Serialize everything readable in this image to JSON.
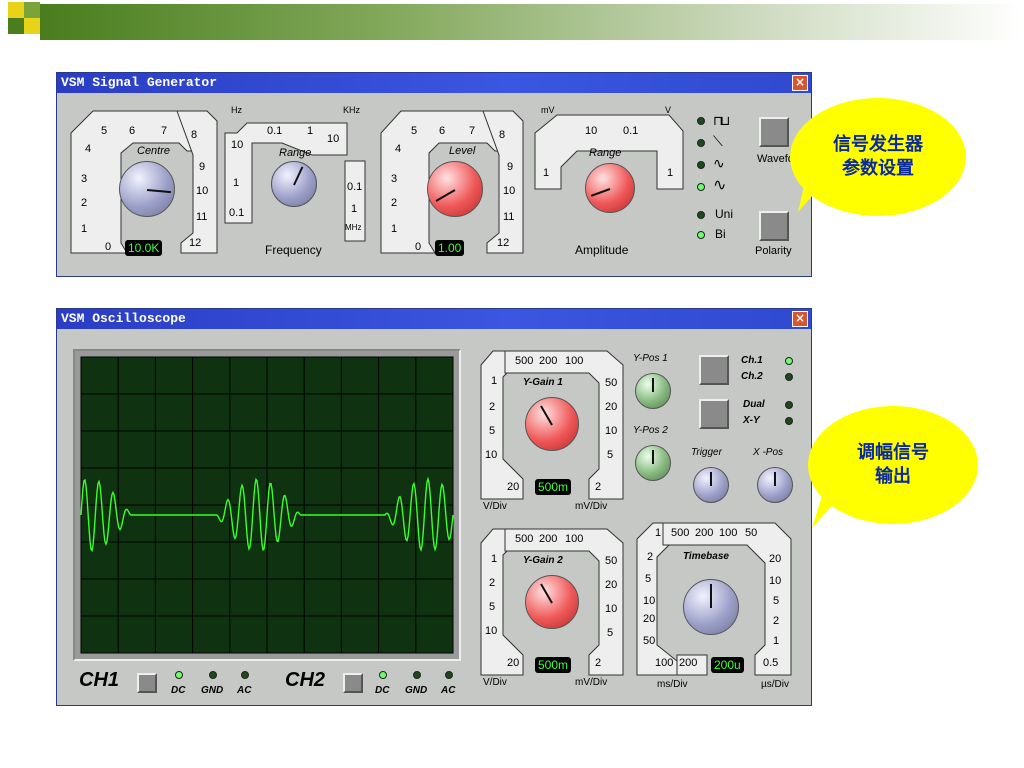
{
  "slide": {
    "callout1": "信号发生器\n参数设置",
    "callout2": "调幅信号\n输出"
  },
  "signal_generator": {
    "title": "VSM Signal Generator",
    "close": "×",
    "centre": {
      "label": "Centre",
      "scale": [
        "5",
        "6",
        "7",
        "8",
        "9",
        "10",
        "11",
        "12",
        "0",
        "1",
        "2",
        "3",
        "4"
      ],
      "display": "10.0K"
    },
    "freq_range": {
      "label": "Range",
      "hz": "Hz",
      "khz": "KHz",
      "mhz": "MHz",
      "top": [
        "0.1",
        "1",
        "10"
      ],
      "left": [
        "10",
        "1",
        "0.1"
      ],
      "right": [
        "0.1",
        "1"
      ],
      "caption": "Frequency"
    },
    "level": {
      "label": "Level",
      "scale": [
        "5",
        "6",
        "7",
        "8",
        "9",
        "10",
        "11",
        "12",
        "0",
        "1",
        "2",
        "3",
        "4"
      ],
      "display": "1.00"
    },
    "amp_range": {
      "label": "Range",
      "mv": "mV",
      "v": "V",
      "top": [
        "10",
        "0.1"
      ],
      "left": "1",
      "right": "1",
      "caption": "Amplitude"
    },
    "wave_buttons": {
      "waveform": "Wavefor",
      "polarity": "Polarity"
    },
    "polarity_opts": {
      "uni": "Uni",
      "bi": "Bi"
    },
    "wave_symbols": [
      "⊓⊔",
      "⟍",
      "∿",
      "∿"
    ]
  },
  "oscilloscope": {
    "title": "VSM Oscilloscope",
    "close": "×",
    "ygain1": {
      "label": "Y-Gain 1",
      "top": [
        "500",
        "200",
        "100"
      ],
      "left": [
        "1",
        "2",
        "5",
        "10",
        "20"
      ],
      "right": [
        "50",
        "20",
        "10",
        "5",
        "2"
      ],
      "display": "500m",
      "vdiv": "V/Div",
      "mvdiv": "mV/Div"
    },
    "ygain2": {
      "label": "Y-Gain 2",
      "top": [
        "500",
        "200",
        "100"
      ],
      "left": [
        "1",
        "2",
        "5",
        "10",
        "20"
      ],
      "right": [
        "50",
        "20",
        "10",
        "5",
        "2"
      ],
      "display": "500m",
      "vdiv": "V/Div",
      "mvdiv": "mV/Div"
    },
    "ypos1": "Y-Pos 1",
    "ypos2": "Y-Pos 2",
    "trigger": "Trigger",
    "xpos": "X -Pos",
    "channels": {
      "ch1": "Ch.1",
      "ch2": "Ch.2",
      "dual": "Dual",
      "xy": "X-Y"
    },
    "timebase": {
      "label": "Timebase",
      "top": [
        "1",
        "500",
        "200",
        "100",
        "50"
      ],
      "left": [
        "2",
        "5",
        "10",
        "20",
        "50"
      ],
      "bottom": [
        "100",
        "200"
      ],
      "right": [
        "20",
        "10",
        "5",
        "2",
        "1",
        "0.5"
      ],
      "display": "200u",
      "msdiv": "ms/Div",
      "usdiv": "µs/Div"
    },
    "ch1_label": "CH1",
    "ch2_label": "CH2",
    "coupling": [
      "DC",
      "GND",
      "AC"
    ],
    "trace_color": "#39ff2a"
  }
}
